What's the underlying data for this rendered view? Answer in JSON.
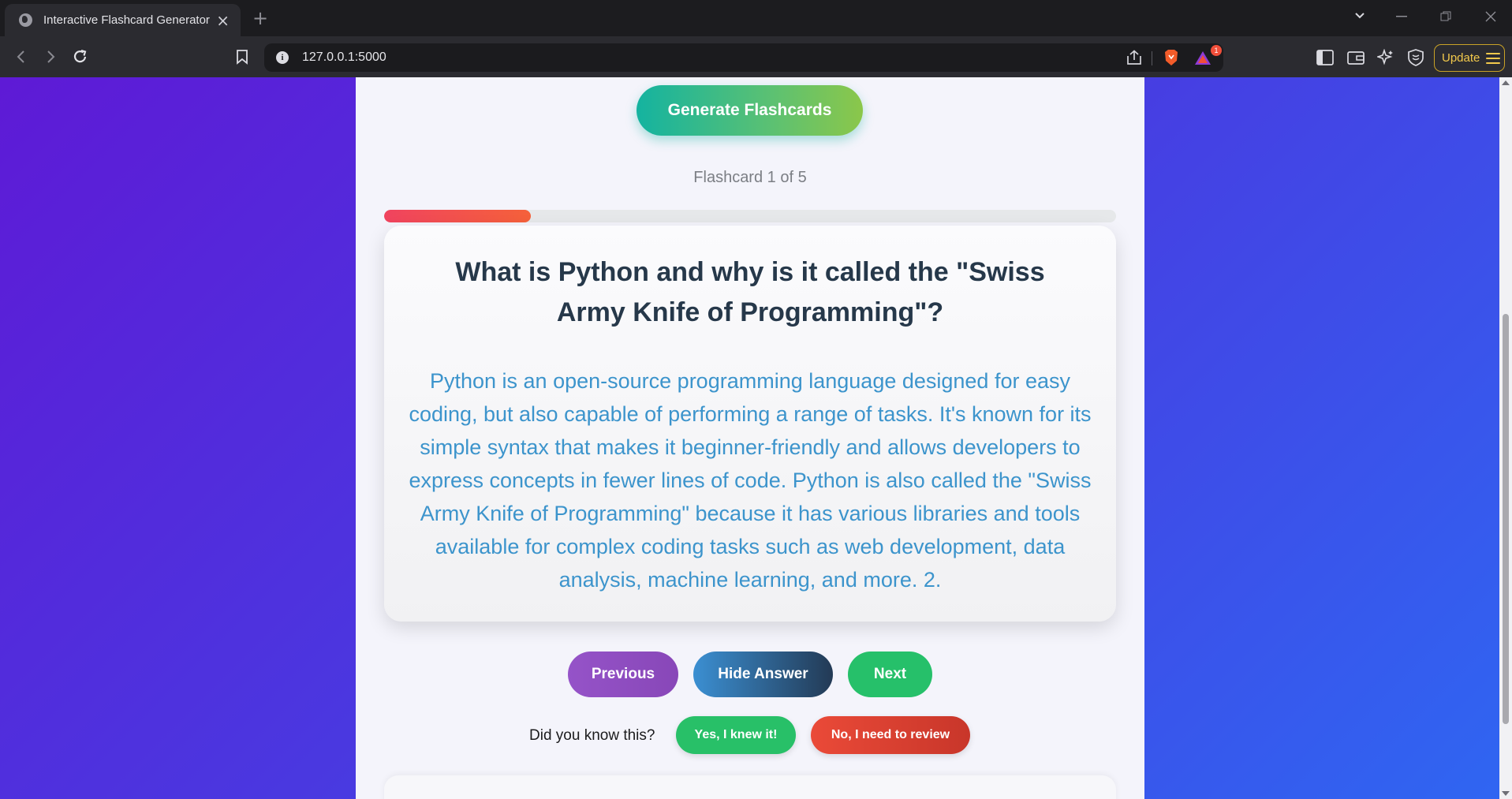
{
  "browser": {
    "tab_title": "Interactive Flashcard Generator",
    "url": "127.0.0.1:5000",
    "notification_count": "1",
    "update_label": "Update"
  },
  "page": {
    "generate_button": "Generate Flashcards",
    "counter_text": "Flashcard 1 of 5",
    "progress_fraction": 0.2,
    "card": {
      "question": "What is Python and why is it called the \"Swiss Army Knife of Programming\"?",
      "answer": "Python is an open-source programming language designed for easy coding, but also capable of performing a range of tasks. It's known for its simple syntax that makes it beginner-friendly and allows developers to express concepts in fewer lines of code. Python is also called the \"Swiss Army Knife of Programming\" because it has various libraries and tools available for complex coding tasks such as web development, data analysis, machine learning, and more. 2."
    },
    "nav": {
      "previous": "Previous",
      "hide_answer": "Hide Answer",
      "next": "Next"
    },
    "review": {
      "prompt": "Did you know this?",
      "yes": "Yes, I knew it!",
      "no": "No, I need to review"
    }
  },
  "colors": {
    "background_start": "#5e1ad6",
    "background_end": "#2f66f2",
    "progress_fill": "#f0435f",
    "question_text": "#26384a",
    "answer_text": "#3c94cc",
    "previous_button": "#9553c8",
    "next_button": "#26c06a",
    "review_yes": "#28c068",
    "review_no": "#ea4a38"
  }
}
